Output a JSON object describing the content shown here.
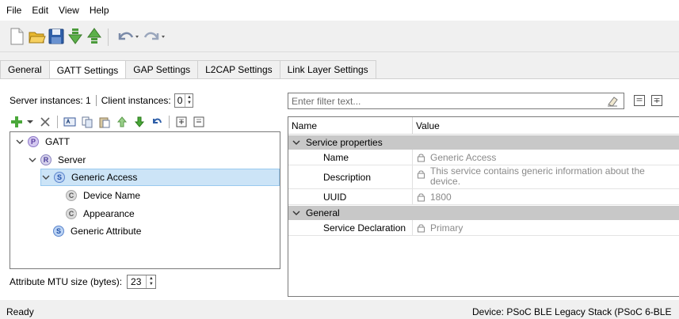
{
  "menu": [
    "File",
    "Edit",
    "View",
    "Help"
  ],
  "toolbar_icons": [
    "new-file-icon",
    "open-folder-icon",
    "save-icon",
    "import-icon",
    "export-icon",
    "undo-icon",
    "redo-icon"
  ],
  "tabs": [
    {
      "label": "General",
      "active": false
    },
    {
      "label": "GATT Settings",
      "active": true
    },
    {
      "label": "GAP Settings",
      "active": false
    },
    {
      "label": "L2CAP Settings",
      "active": false
    },
    {
      "label": "Link Layer Settings",
      "active": false
    }
  ],
  "left": {
    "server_instances": "Server instances: 1",
    "client_instances_label": "Client instances:",
    "client_instances_value": "0",
    "mtu_label": "Attribute MTU size (bytes):",
    "mtu_value": "23",
    "tree": [
      {
        "label": "GATT",
        "badge": "P",
        "expanded": true
      },
      {
        "label": "Server",
        "badge": "R",
        "expanded": true
      },
      {
        "label": "Generic Access",
        "badge": "S",
        "expanded": true,
        "selected": true
      },
      {
        "label": "Device Name",
        "badge": "C"
      },
      {
        "label": "Appearance",
        "badge": "C"
      },
      {
        "label": "Generic Attribute",
        "badge": "S"
      }
    ]
  },
  "right": {
    "filter_placeholder": "Enter filter text...",
    "columns": {
      "name": "Name",
      "value": "Value"
    },
    "categories": [
      {
        "label": "Service properties",
        "rows": [
          {
            "name": "Name",
            "value": "Generic Access"
          },
          {
            "name": "Description",
            "value_line1": "This service contains generic information about the",
            "value_line2": "device."
          },
          {
            "name": "UUID",
            "value": "1800"
          }
        ]
      },
      {
        "label": "General",
        "rows": [
          {
            "name": "Service Declaration",
            "value": "Primary"
          }
        ]
      }
    ]
  },
  "status": {
    "left": "Ready",
    "right": "Device: PSoC BLE Legacy Stack (PSoC 6-BLE"
  }
}
